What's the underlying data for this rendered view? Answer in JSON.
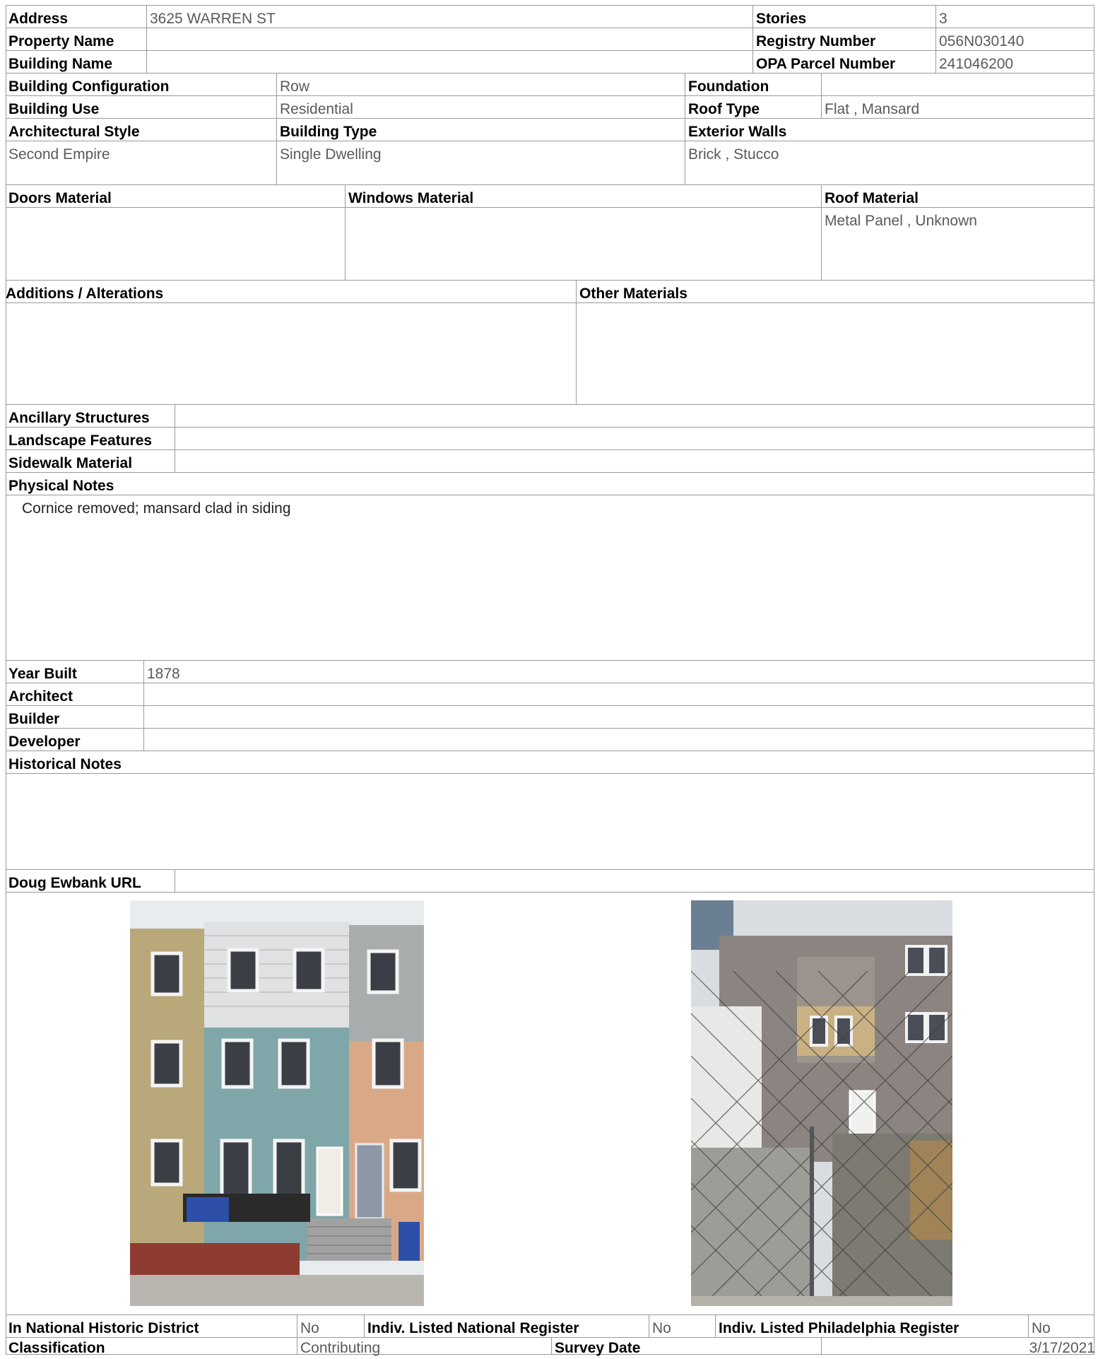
{
  "fields": {
    "address": {
      "label": "Address",
      "value": "3625 WARREN ST"
    },
    "stories": {
      "label": "Stories",
      "value": "3"
    },
    "property_name": {
      "label": "Property Name",
      "value": ""
    },
    "registry_number": {
      "label": "Registry Number",
      "value": "056N030140"
    },
    "building_name": {
      "label": "Building Name",
      "value": ""
    },
    "opa_parcel": {
      "label": "OPA Parcel Number",
      "value": "241046200"
    },
    "building_configuration": {
      "label": "Building Configuration",
      "value": "Row"
    },
    "foundation": {
      "label": "Foundation",
      "value": ""
    },
    "building_use": {
      "label": "Building Use",
      "value": "Residential"
    },
    "roof_type": {
      "label": "Roof Type",
      "value": "Flat , Mansard"
    },
    "architectural_style": {
      "label": "Architectural Style",
      "value": "Second Empire"
    },
    "building_type": {
      "label": "Building Type",
      "value": "Single Dwelling"
    },
    "exterior_walls": {
      "label": "Exterior Walls",
      "value": "Brick , Stucco"
    },
    "doors_material": {
      "label": "Doors Material",
      "value": ""
    },
    "windows_material": {
      "label": "Windows Material",
      "value": ""
    },
    "roof_material": {
      "label": "Roof Material",
      "value": "Metal Panel , Unknown"
    },
    "additions_alterations": {
      "label": "Additions / Alterations",
      "value": ""
    },
    "other_materials": {
      "label": "Other Materials",
      "value": ""
    },
    "ancillary_structures": {
      "label": "Ancillary Structures",
      "value": ""
    },
    "landscape_features": {
      "label": "Landscape Features",
      "value": ""
    },
    "sidewalk_material": {
      "label": "Sidewalk Material",
      "value": ""
    },
    "physical_notes": {
      "label": "Physical Notes",
      "value": "Cornice removed; mansard clad in siding"
    },
    "year_built": {
      "label": "Year Built",
      "value": "1878"
    },
    "architect": {
      "label": "Architect",
      "value": ""
    },
    "builder": {
      "label": "Builder",
      "value": ""
    },
    "developer": {
      "label": "Developer",
      "value": ""
    },
    "historical_notes": {
      "label": "Historical Notes",
      "value": ""
    },
    "doug_ewbank_url": {
      "label": "Doug Ewbank URL",
      "value": ""
    },
    "national_historic_district": {
      "label": "In National Historic District",
      "value": "No"
    },
    "indiv_national_register": {
      "label": "Indiv. Listed National Register",
      "value": "No"
    },
    "indiv_philadelphia_register": {
      "label": "Indiv. Listed Philadelphia Register",
      "value": "No"
    },
    "classification": {
      "label": "Classification",
      "value": "Contributing"
    },
    "survey_date": {
      "label": "Survey Date",
      "value": "3/17/2021"
    }
  },
  "photos": {
    "front": "front-facade-photo",
    "rear": "rear-facade-photo"
  }
}
